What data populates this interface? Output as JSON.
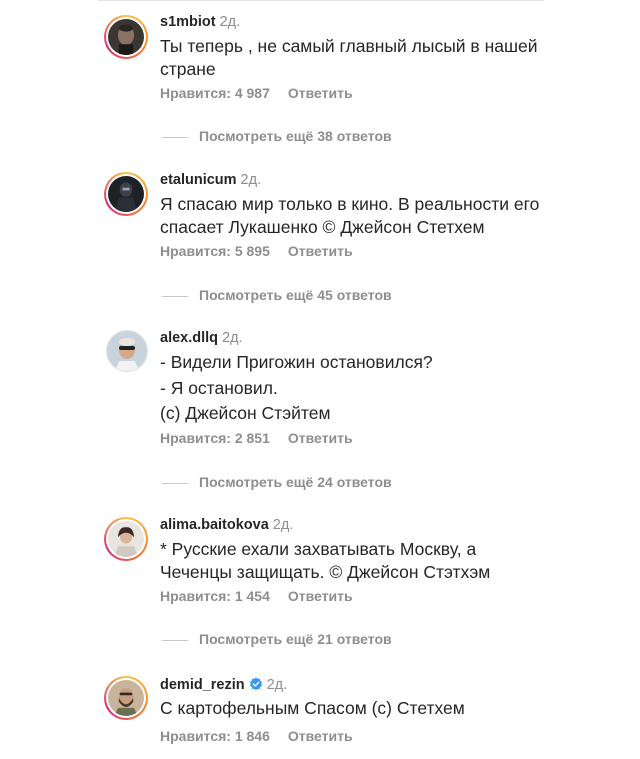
{
  "comments": [
    {
      "username": "s1mbiot",
      "time": "2д.",
      "verified": false,
      "text_lines": [
        "Ты теперь , не самый главный лысый в нашей",
        "стране"
      ],
      "likes": "Нравится: 4 987",
      "reply": "Ответить",
      "more_replies": "Посмотреть ещё 38 ответов",
      "avatar": "dark-portrait"
    },
    {
      "username": "etalunicum",
      "time": "2д.",
      "verified": false,
      "text_lines": [
        "Я спасаю мир только в кино. В реальности его",
        "спасает Лукашенко © Джейсон Стетхем"
      ],
      "likes": "Нравится: 5 895",
      "reply": "Ответить",
      "more_replies": "Посмотреть ещё 45 ответов",
      "avatar": "dark-figure"
    },
    {
      "username": "alex.dllq",
      "time": "2д.",
      "verified": false,
      "text_lines": [
        "- Видели Пригожин остановился?",
        "- Я остановил.",
        "(с) Джейсон Стэйтем"
      ],
      "likes": "Нравится: 2 851",
      "reply": "Ответить",
      "more_replies": "Посмотреть ещё 24 ответов",
      "avatar": "sunglasses-man"
    },
    {
      "username": "alima.baitokova",
      "time": "2д.",
      "verified": false,
      "text_lines": [
        "* Русские ехали захватывать Москву, а",
        "Чеченцы защищать. © Джейсон Стэтхэм"
      ],
      "likes": "Нравится: 1 454",
      "reply": "Ответить",
      "more_replies": "Посмотреть ещё 21 ответов",
      "avatar": "woman-portrait"
    },
    {
      "username": "demid_rezin",
      "time": "2д.",
      "verified": true,
      "text_lines": [
        "С картофельным Спасом (с) Стетхем"
      ],
      "likes": "Нравится: 1 846",
      "reply": "Ответить",
      "more_replies": "",
      "avatar": "bearded-man"
    }
  ],
  "colors": {
    "text": "#262626",
    "secondary": "#8e8e8e",
    "verified": "#3897f0"
  }
}
